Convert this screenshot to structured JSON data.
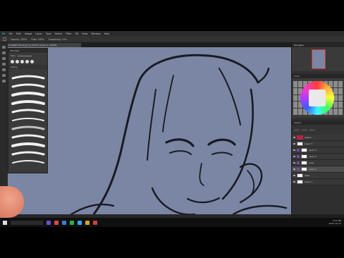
{
  "app": {
    "name": "Ps"
  },
  "menu": {
    "items": [
      "File",
      "Edit",
      "Image",
      "Layer",
      "Type",
      "Select",
      "Filter",
      "3D",
      "View",
      "Window",
      "Help"
    ]
  },
  "options": {
    "opacity": "Opacity: 100%",
    "flow": "Flow: 100%",
    "smoothing": "Smoothing: 10%"
  },
  "document": {
    "tab": "CHAR2 FANNE FOLIO.psd @ 28.6% (Layer 2, RGB/8)"
  },
  "brush_panel": {
    "title": "Brushes",
    "size": "Size:",
    "folder": "Inking"
  },
  "right_panel": {
    "navigator": "Navigator",
    "colors": "Color",
    "layers": "Layers"
  },
  "layers": {
    "items": [
      {
        "name": "sketch"
      },
      {
        "name": "Layer 3"
      },
      {
        "name": "Layer 4"
      },
      {
        "name": "Layer 5"
      },
      {
        "name": "lines"
      },
      {
        "name": "Layer 2"
      },
      {
        "name": "base"
      },
      {
        "name": "Layer 1"
      }
    ]
  },
  "status": {
    "text": "28.57%"
  },
  "taskbar": {
    "time": "3:11 PM",
    "date": "2017-10-17"
  },
  "colors": {
    "canvas": "#7a86a4",
    "accent": "#31a8ff",
    "group": "#7a45a8"
  }
}
